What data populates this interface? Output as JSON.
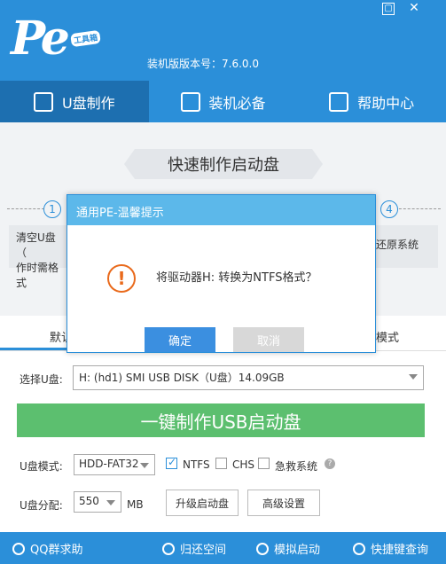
{
  "header": {
    "logo_text": "Pe",
    "logo_badge": "工具箱",
    "version_label": "装机版版本号：7.6.0.0"
  },
  "tabs": [
    {
      "label": "U盘制作",
      "icon": "usb-icon"
    },
    {
      "label": "装机必备",
      "icon": "grid-icon"
    },
    {
      "label": "帮助中心",
      "icon": "help-icon"
    }
  ],
  "main": {
    "ribbon_title": "快速制作启动盘",
    "steps": [
      "1",
      "4"
    ],
    "step1_text_line1": "清空U盘（",
    "step1_text_line2": "作时需格式",
    "step4_text": "还原系统",
    "subtab_left": "默认",
    "subtab_right": "模式"
  },
  "form": {
    "select_udisk_label": "选择U盘:",
    "udisk_value": "H: (hd1) SMI USB DISK（U盘）14.09GB",
    "make_button": "一键制作USB启动盘",
    "udisk_mode_label": "U盘模式:",
    "mode_value": "HDD-FAT32",
    "ntfs_label": "NTFS",
    "ntfs_checked": true,
    "chs_label": "CHS",
    "rescue_label": "急救系统",
    "alloc_label": "U盘分配:",
    "alloc_value": "550",
    "alloc_unit": "MB",
    "upgrade_button": "升级启动盘",
    "advanced_button": "高级设置"
  },
  "footer": {
    "qq": "QQ群求助",
    "restore": "归还空间",
    "simulate": "模拟启动",
    "shortcut": "快捷键查询"
  },
  "modal": {
    "title": "通用PE-温馨提示",
    "message": "将驱动器H: 转换为NTFS格式？",
    "ok": "确定",
    "cancel": "取消"
  },
  "colors": {
    "brand_blue": "#2b8fd9",
    "make_green": "#5cbf6f",
    "warn_orange": "#e96a1c"
  }
}
